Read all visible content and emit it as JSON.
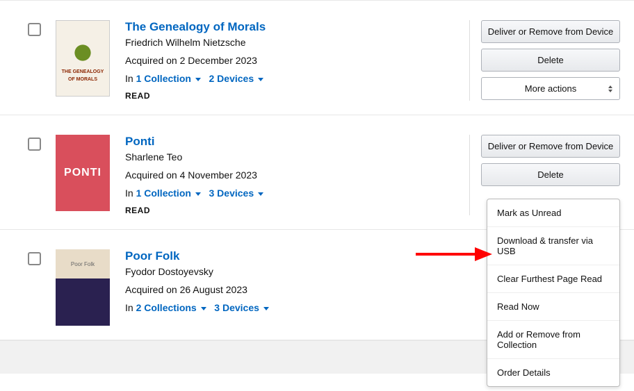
{
  "books": [
    {
      "title": "The Genealogy of Morals",
      "author": "Friedrich Wilhelm Nietzsche",
      "acquired": "Acquired on 2 December 2023",
      "in_label": "In",
      "collections": "1 Collection",
      "devices": "2 Devices",
      "read_label": "READ",
      "cover_line1": "THE GENEALOGY",
      "cover_line2": "OF MORALS"
    },
    {
      "title": "Ponti",
      "author": "Sharlene Teo",
      "acquired": "Acquired on 4 November 2023",
      "in_label": "In",
      "collections": "1 Collection",
      "devices": "3 Devices",
      "read_label": "READ",
      "cover_text": "PONTI"
    },
    {
      "title": "Poor Folk",
      "author": "Fyodor Dostoyevsky",
      "acquired": "Acquired on 26 August 2023",
      "in_label": "In",
      "collections": "2 Collections",
      "devices": "3 Devices",
      "cover_top": "Poor Folk"
    }
  ],
  "actions": {
    "deliver": "Deliver or Remove from Device",
    "delete": "Delete",
    "more": "More actions"
  },
  "dropdown": {
    "mark_unread": "Mark as Unread",
    "download_usb": "Download & transfer via USB",
    "clear_furthest": "Clear Furthest Page Read",
    "read_now": "Read Now",
    "add_remove_collection": "Add or Remove from Collection",
    "order_details": "Order Details"
  }
}
